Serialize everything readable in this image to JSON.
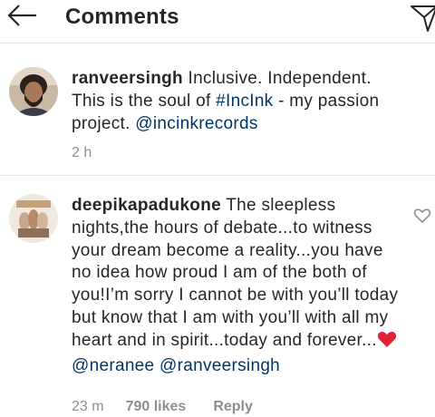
{
  "header": {
    "title": "Comments",
    "back_icon": "arrow-left-icon",
    "send_icon": "direct-send-icon"
  },
  "comments": [
    {
      "username": "ranveersingh",
      "text_before": " Inclusive. Independent. This is the soul of ",
      "hashtag": "#IncInk",
      "text_middle": " - my passion project. ",
      "mention": "@incinkrecords",
      "time": "2 h",
      "avatar": "profile-photo"
    },
    {
      "username": "deepikapadukone",
      "text_before": " The sleepless nights,the hours of debate...to witness your dream become a reality...you have no idea how proud I am of the both of you!I’m sorry I cannot be with you’ll today but know that I am with you’ll with all my heart and in spirit...today and forever...",
      "emoji": "red-heart-emoji",
      "mention_1": "@neranee",
      "mention_2": "@ranveersingh",
      "time": "23 m",
      "likes": "790 likes",
      "reply": "Reply",
      "avatar": "magazine-cover-photo"
    }
  ],
  "colors": {
    "link": "#003569",
    "meta": "#8e8e8e",
    "text": "#262626",
    "heart": "#e0213a"
  }
}
